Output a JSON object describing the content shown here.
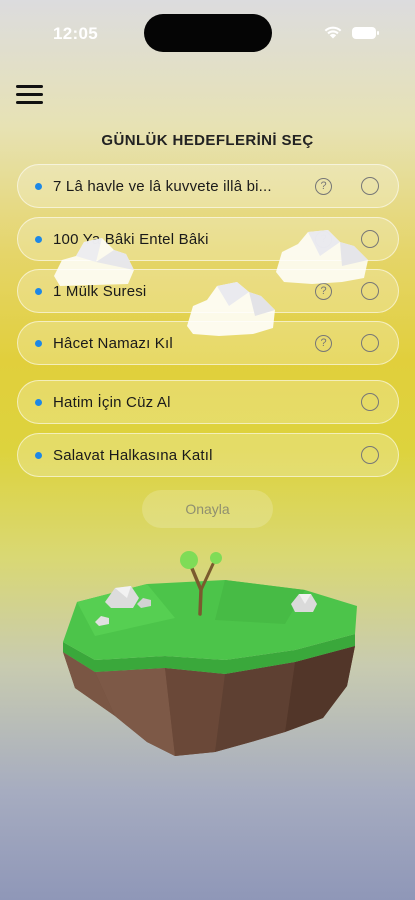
{
  "status_bar": {
    "time": "12:05"
  },
  "header": {
    "menu_icon": "hamburger-menu-icon",
    "title": "GÜNLÜK HEDEFLERİNİ SEÇ"
  },
  "goals": [
    {
      "label": "7 Lâ havle ve lâ kuvvete illâ bi...",
      "has_info": true,
      "selected": false
    },
    {
      "label": "100 Ya Bâki Entel Bâki",
      "has_info": true,
      "selected": false
    },
    {
      "label": "1 Mülk Suresi",
      "has_info": true,
      "selected": false
    },
    {
      "label": "Hâcet Namazı Kıl",
      "has_info": true,
      "selected": false
    },
    {
      "label": "Hatim İçin Cüz Al",
      "has_info": false,
      "selected": false
    },
    {
      "label": "Salavat Halkasına Katıl",
      "has_info": false,
      "selected": false
    }
  ],
  "info_glyph": "?",
  "confirm_label": "Onayla",
  "colors": {
    "bullet": "#1e88e5",
    "grass": "#4cc44a",
    "soil": "#6b4a3a"
  }
}
